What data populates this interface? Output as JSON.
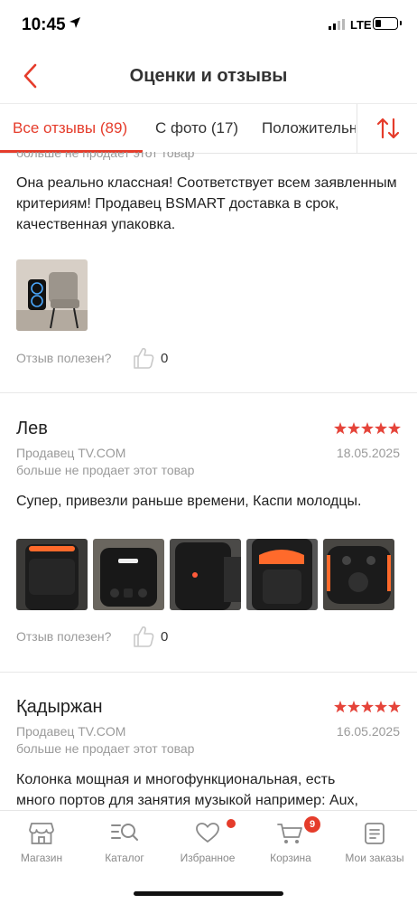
{
  "status_bar": {
    "time": "10:45",
    "network": "LTE",
    "icons": [
      "location-arrow-icon",
      "signal-icon",
      "battery-icon"
    ]
  },
  "header": {
    "title": "Оценки и отзывы",
    "back_icon": "chevron-left-icon"
  },
  "tabs": [
    {
      "label": "Все отзывы (89)",
      "active": true
    },
    {
      "label": "С фото (17)",
      "active": false
    },
    {
      "label": "Положительные",
      "active": false
    }
  ],
  "sort_icon": "sort-arrows-icon",
  "accent_color": "#e53c2b",
  "reviews": [
    {
      "cut_line": "больше не продает этот товар",
      "text": "Она реально классная! Соответствует всем заявленным критериям! Продавец BSMART доставка в срок, качественная упаковка.",
      "photos": 1,
      "helpful_label": "Отзыв полезен?",
      "helpful_count": "0"
    },
    {
      "name": "Лев",
      "rating": 5,
      "seller": "Продавец TV.COM",
      "date": "18.05.2025",
      "seller_note": "больше не продает этот товар",
      "text": "Супер, привезли раньше времени, Каспи молодцы.",
      "photos": 5,
      "helpful_label": "Отзыв полезен?",
      "helpful_count": "0"
    },
    {
      "name": "Қадыржан",
      "rating": 5,
      "seller": "Продавец TV.COM",
      "date": "16.05.2025",
      "seller_note": "больше не продает этот товар",
      "text_line1": "Колонка мощная и многофункциональная, есть",
      "text_line2": "много портов для занятия музыкой например: Aux,"
    }
  ],
  "bottom_nav": [
    {
      "label": "Магазин",
      "icon": "shop-icon"
    },
    {
      "label": "Каталог",
      "icon": "catalog-search-icon"
    },
    {
      "label": "Избранное",
      "icon": "heart-icon",
      "dot": true
    },
    {
      "label": "Корзина",
      "icon": "cart-icon",
      "badge": "9"
    },
    {
      "label": "Мои заказы",
      "icon": "orders-icon"
    }
  ]
}
